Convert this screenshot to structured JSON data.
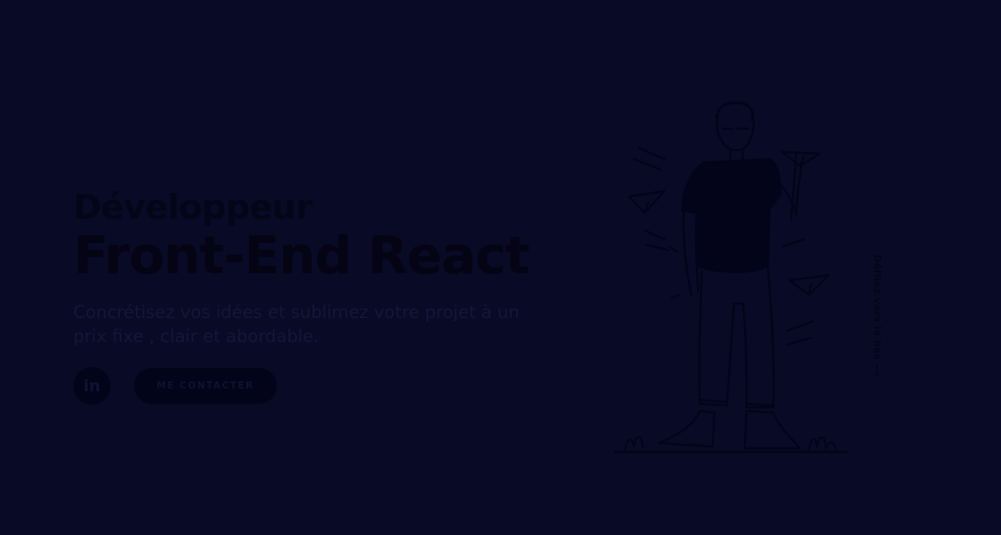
{
  "colors": {
    "background": "#090a25",
    "heading": "#05051a",
    "text": "#14163a",
    "button": "#03031a"
  },
  "hero": {
    "subtitle": "Développeur",
    "title": "Front-End React",
    "tagline": "Concrétisez vos idées et sublimez votre projet à un prix fixe , clair et abordable."
  },
  "actions": {
    "linkedin_icon": "linkedin-icon",
    "linkedin_label": "in",
    "contact_label": "ME CONTACTER"
  },
  "scroll_hint": {
    "label": "Défilez vers le bas",
    "arrow": "⟶"
  },
  "illustration": {
    "icon": "developer-paper-plane-illustration"
  }
}
